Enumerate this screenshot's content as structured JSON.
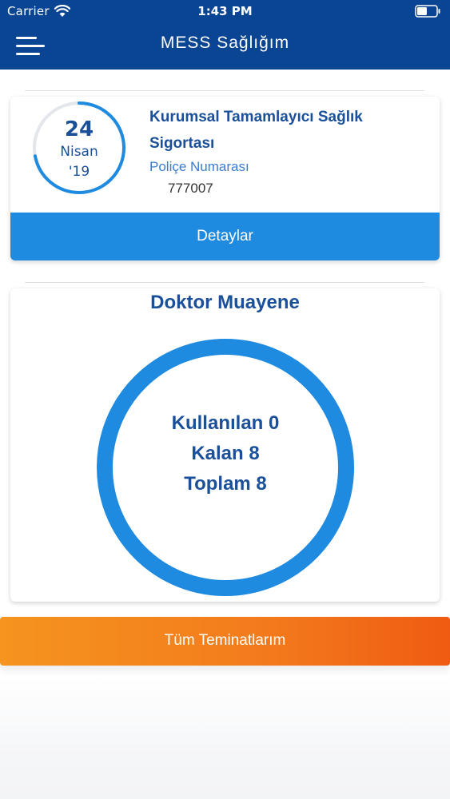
{
  "status_bar": {
    "carrier": "Carrier",
    "time": "1:43 PM",
    "wifi_icon": "wifi-icon",
    "battery_icon": "battery-icon"
  },
  "nav": {
    "title": "MESS Sağlığım",
    "menu_icon": "hamburger-menu-icon"
  },
  "policy_card": {
    "date": {
      "day": "24",
      "month": "Nisan",
      "year": "'19"
    },
    "date_ring_progress": 0.72,
    "title": "Kurumsal Tamamlayıcı Sağlık Sigortası",
    "policy_label": "Poliçe Numarası",
    "policy_number": "777007",
    "details_label": "Detaylar"
  },
  "exam_card": {
    "title": "Doktor Muayene",
    "used": "Kullanılan 0",
    "remaining": "Kalan 8",
    "total": "Toplam 8",
    "used_count": 0,
    "total_count": 8
  },
  "all_coverages_label": "Tüm Teminatlarım",
  "colors": {
    "nav_bg": "#0a4594",
    "primary_text": "#1a4f99",
    "accent_blue": "#1e8ae0",
    "orange_start": "#f5941f",
    "orange_end": "#ef5b12"
  }
}
